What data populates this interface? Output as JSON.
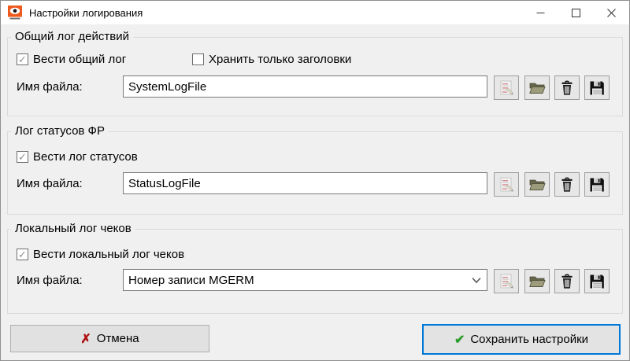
{
  "colors": {
    "accent_blue": "#0078d7",
    "cancel_red": "#b01010",
    "save_green": "#2e9e2e",
    "app_icon_orange": "#ee5a1e",
    "folder_olive": "#9c9c7c",
    "window_bg": "#f0f0f0",
    "titlebar_bg": "#ffffff"
  },
  "window": {
    "title": "Настройки логирования"
  },
  "groups": [
    {
      "title": "Общий лог действий",
      "checkboxes": [
        {
          "label": "Вести общий лог",
          "checked": true
        },
        {
          "label": "Хранить только заголовки",
          "checked": false
        }
      ],
      "filename_label": "Имя файла:",
      "filename_value": "SystemLogFile",
      "field_type": "text"
    },
    {
      "title": "Лог статусов ФР",
      "checkboxes": [
        {
          "label": "Вести лог статусов",
          "checked": true
        }
      ],
      "filename_label": "Имя файла:",
      "filename_value": "StatusLogFile",
      "field_type": "text"
    },
    {
      "title": "Локальный лог чеков",
      "checkboxes": [
        {
          "label": "Вести локальный лог чеков",
          "checked": true
        }
      ],
      "filename_label": "Имя файла:",
      "filename_value": "Номер записи MGERM",
      "field_type": "combobox"
    }
  ],
  "footer": {
    "cancel_label": "Отмена",
    "save_label": "Сохранить настройки"
  },
  "icons": {
    "cancel_x": "✗",
    "save_check": "✔",
    "checkbox_check": "✓",
    "toolbar": [
      "notes-icon",
      "folder-open-icon",
      "trash-icon",
      "floppy-icon"
    ],
    "titlebar": [
      "minimize-icon",
      "maximize-icon",
      "close-icon"
    ]
  }
}
